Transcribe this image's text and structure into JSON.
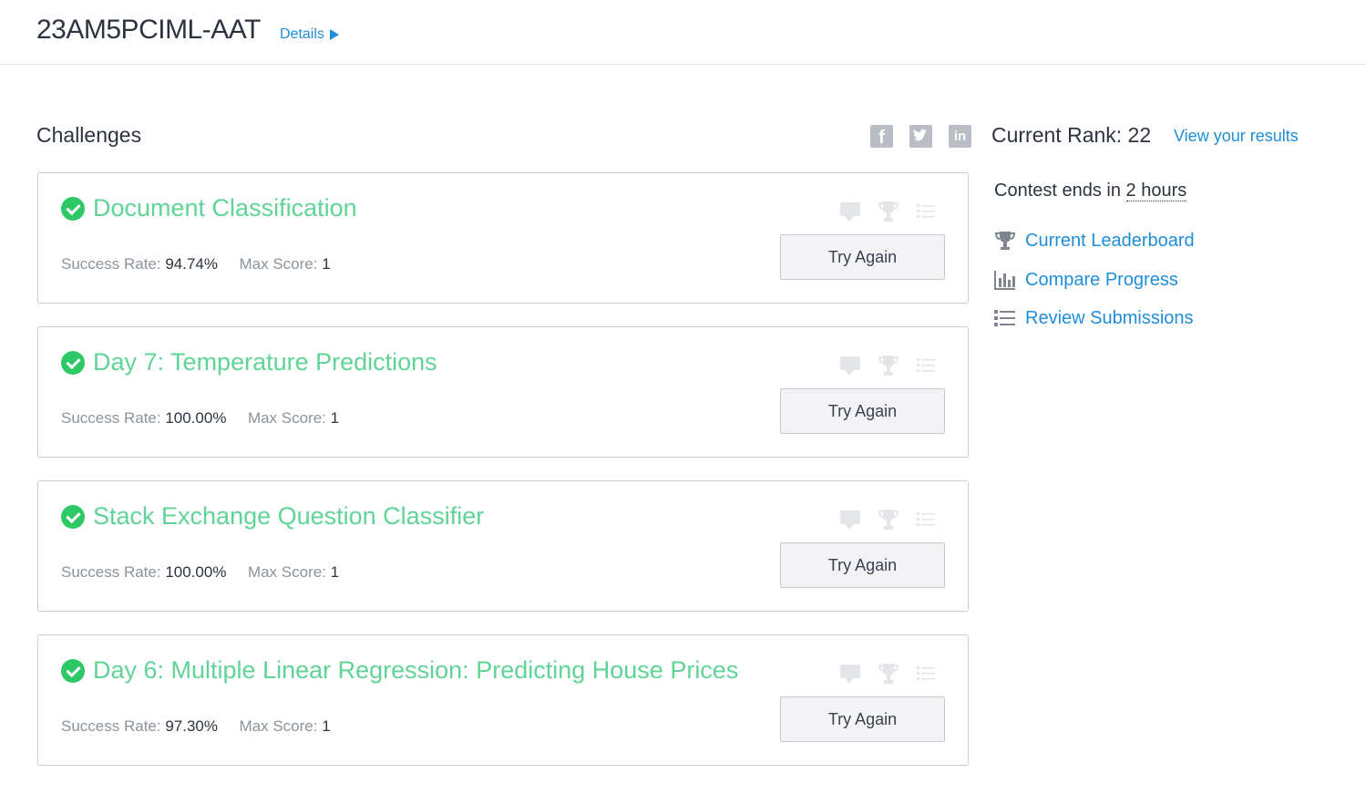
{
  "header": {
    "contest_title": "23AM5PCIML-AAT",
    "details_label": "Details"
  },
  "challenges_section": {
    "title": "Challenges"
  },
  "rank": {
    "label": "Current Rank: 22",
    "view_results": "View your results"
  },
  "contest": {
    "ends_prefix": "Contest ends in",
    "ends_value": "2 hours"
  },
  "sidebar_links": [
    {
      "label": "Current Leaderboard",
      "icon": "trophy-icon"
    },
    {
      "label": "Compare Progress",
      "icon": "bar-chart-icon"
    },
    {
      "label": "Review Submissions",
      "icon": "list-icon"
    }
  ],
  "stat_labels": {
    "success_rate": "Success Rate:",
    "max_score": "Max Score:"
  },
  "challenges": [
    {
      "title": "Document Classification",
      "success_rate": "94.74%",
      "max_score": "1",
      "button": "Try Again"
    },
    {
      "title": "Day 7: Temperature Predictions",
      "success_rate": "100.00%",
      "max_score": "1",
      "button": "Try Again"
    },
    {
      "title": "Stack Exchange Question Classifier",
      "success_rate": "100.00%",
      "max_score": "1",
      "button": "Try Again"
    },
    {
      "title": "Day 6: Multiple Linear Regression: Predicting House Prices",
      "success_rate": "97.30%",
      "max_score": "1",
      "button": "Try Again"
    }
  ],
  "social": {
    "facebook": "f",
    "linkedin": "in"
  },
  "colors": {
    "accent": "#1f8ed8",
    "solved_title": "#5fd496",
    "check": "#2ec866"
  }
}
